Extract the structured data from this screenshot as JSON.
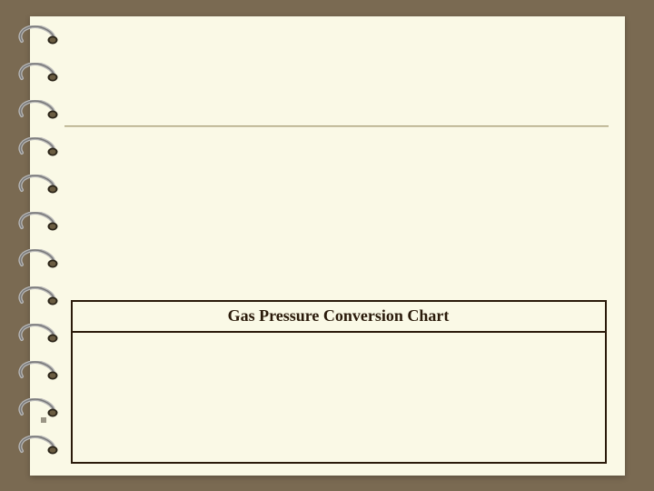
{
  "page": {
    "title": "Gas Pressure Conversion Chart"
  }
}
